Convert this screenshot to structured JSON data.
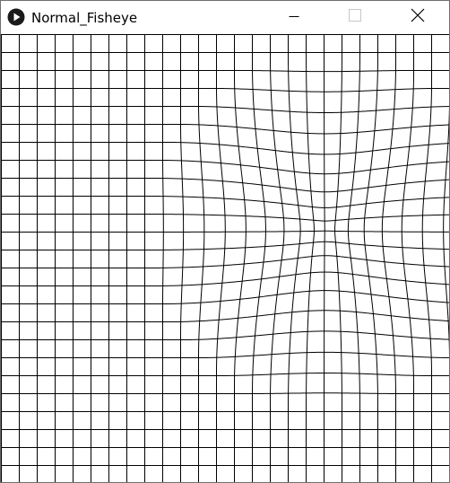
{
  "window": {
    "title": "Normal_Fisheye",
    "icons": {
      "app": "processing-play-icon",
      "minimize": "minimize-icon",
      "maximize": "maximize-icon",
      "close": "close-icon"
    },
    "colors": {
      "titlebar_bg": "#ffffff",
      "title_text": "#000000",
      "disabled_button": "#c8c8c8",
      "grid_line": "#000000",
      "canvas_bg": "#ffffff"
    }
  },
  "sketch": {
    "content": "grid-with-fisheye-distortion"
  }
}
